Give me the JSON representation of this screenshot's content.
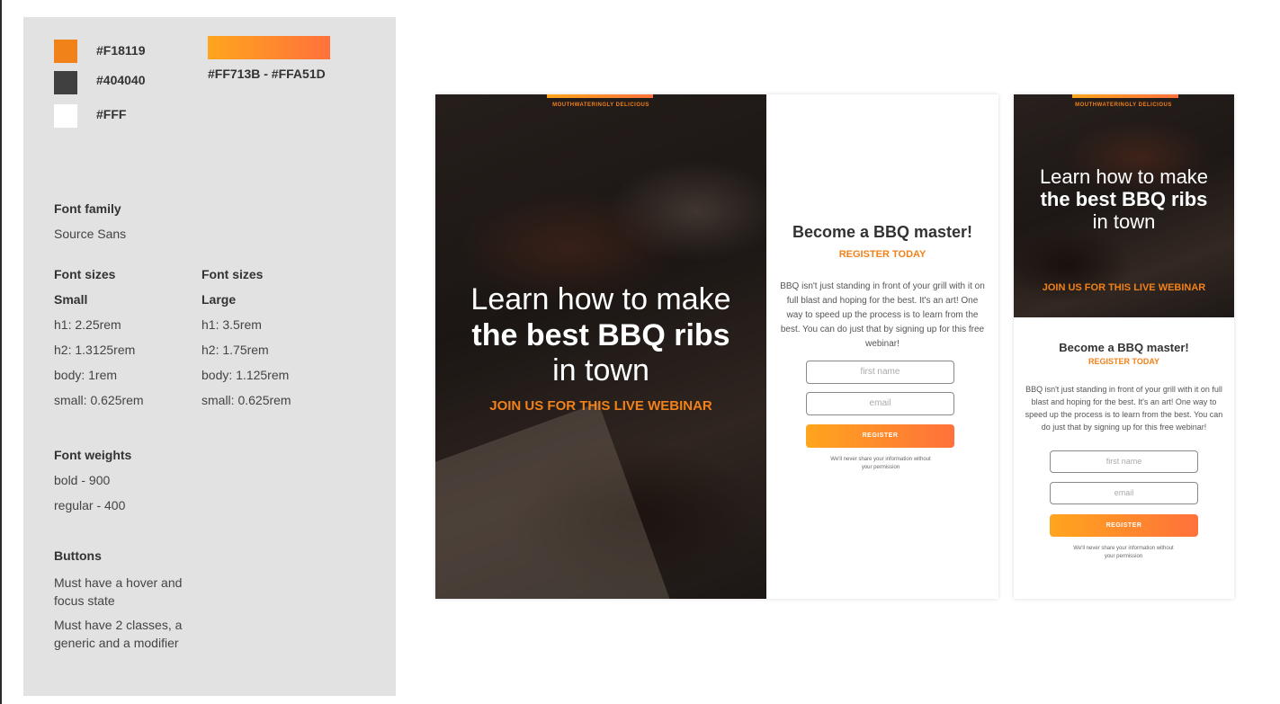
{
  "colors": {
    "primary": "#F18119",
    "dark": "#404040",
    "light": "#FFF",
    "gradient": "#FF713B - #FFA51D"
  },
  "guide": {
    "font_family_heading": "Font family",
    "font_family_value": "Source Sans",
    "sizes_small_heading": "Font sizes",
    "sizes_small_sub": "Small",
    "sizes_small": [
      "h1: 2.25rem",
      "h2: 1.3125rem",
      "body: 1rem",
      "small: 0.625rem"
    ],
    "sizes_large_heading": "Font sizes",
    "sizes_large_sub": "Large",
    "sizes_large": [
      "h1: 3.5rem",
      "h2: 1.75rem",
      "body: 1.125rem",
      "small: 0.625rem"
    ],
    "weights_heading": "Font weights",
    "weights": [
      "bold - 900",
      "regular - 400"
    ],
    "buttons_heading": "Buttons",
    "buttons_note1": "Must have a hover and focus state",
    "buttons_note2": "Must have 2 classes, a generic and a modifier"
  },
  "mockup": {
    "tagline": "MOUTHWATERINGLY DELICIOUS",
    "h1_line1": "Learn how to make",
    "h1_line2": "the best BBQ ribs",
    "h1_line3": "in town",
    "subheading": "JOIN US FOR THIS LIVE WEBINAR",
    "form_title": "Become a BBQ master!",
    "form_register_label": "REGISTER TODAY",
    "form_body": "BBQ isn't just standing in front of your grill with it on full blast and hoping for the best. It's an art! One way to speed up the process is to learn from the best. You can do just that by signing up for this free webinar!",
    "first_name_placeholder": "first name",
    "email_placeholder": "email",
    "register_button": "REGISTER",
    "privacy_note": "We'll never share your information without your permission"
  }
}
